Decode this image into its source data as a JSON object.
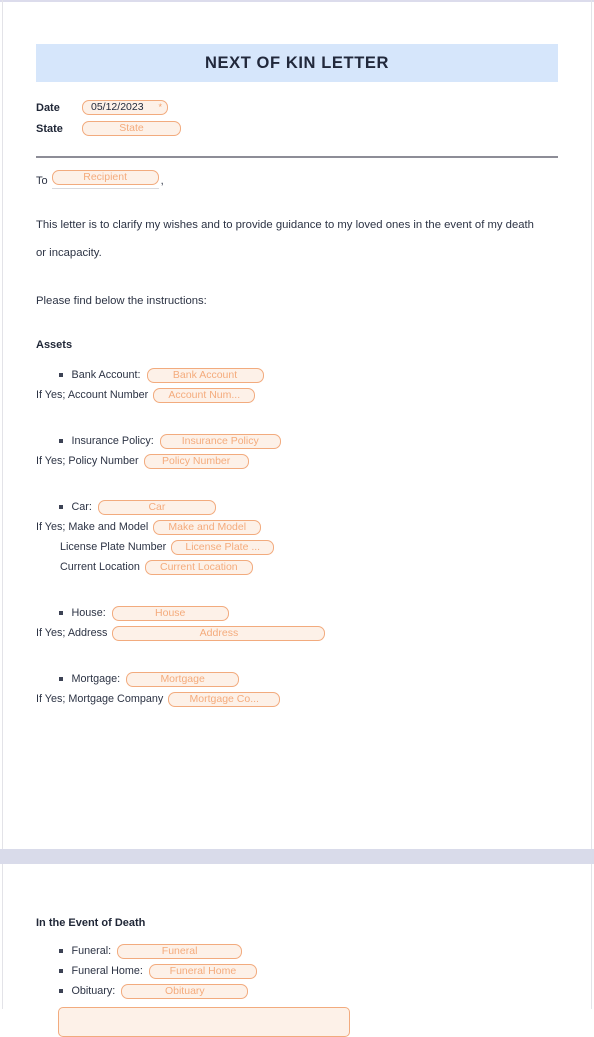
{
  "document": {
    "title": "NEXT OF KIN LETTER"
  },
  "meta": {
    "date_label": "Date",
    "date_value": "05/12/2023",
    "required_marker": "*",
    "state_label": "State",
    "state_placeholder": "State"
  },
  "salutation": {
    "to_label": "To",
    "recipient_placeholder": "Recipient",
    "comma": ","
  },
  "body": {
    "paragraph1": "This letter is to clarify my wishes and to provide guidance to my loved ones in the event of my death or incapacity.",
    "paragraph2": "Please find below the instructions:"
  },
  "assets": {
    "heading": "Assets",
    "items": [
      {
        "label": "Bank Account:",
        "placeholder": "Bank Account",
        "subfields": [
          {
            "label": "If Yes; Account Number",
            "placeholder": "Account Num...",
            "indent": 0
          }
        ]
      },
      {
        "label": "Insurance Policy:",
        "placeholder": "Insurance Policy",
        "subfields": [
          {
            "label": "If Yes; Policy Number",
            "placeholder": "Policy Number",
            "indent": 0
          }
        ]
      },
      {
        "label": "Car:",
        "placeholder": "Car",
        "subfields": [
          {
            "label": "If Yes; Make and Model",
            "placeholder": "Make and Model",
            "indent": 0
          },
          {
            "label": "License Plate Number",
            "placeholder": "License Plate ...",
            "indent": 1
          },
          {
            "label": "Current Location",
            "placeholder": "Current Location",
            "indent": 1
          }
        ]
      },
      {
        "label": "House:",
        "placeholder": "House",
        "subfields": [
          {
            "label": "If Yes; Address",
            "placeholder": "Address",
            "indent": 0
          }
        ]
      },
      {
        "label": "Mortgage:",
        "placeholder": "Mortgage",
        "subfields": [
          {
            "label": "If Yes; Mortgage Company",
            "placeholder": "Mortgage Co...",
            "indent": 0
          }
        ]
      }
    ]
  },
  "death": {
    "heading": "In the Event of Death",
    "items": [
      {
        "label": "Funeral:",
        "placeholder": "Funeral"
      },
      {
        "label": "Funeral Home:",
        "placeholder": "Funeral Home"
      },
      {
        "label": "Obituary:",
        "placeholder": "Obituary"
      }
    ],
    "notes_placeholder": ""
  },
  "colors": {
    "banner": "#d6e6fb",
    "field_border": "#f2ab7e",
    "field_fill": "#fdf1e8",
    "field_text": "#f4ab7c",
    "text": "#2c3344",
    "rule": "#8d8d97",
    "page_break": "#d9dbea"
  }
}
